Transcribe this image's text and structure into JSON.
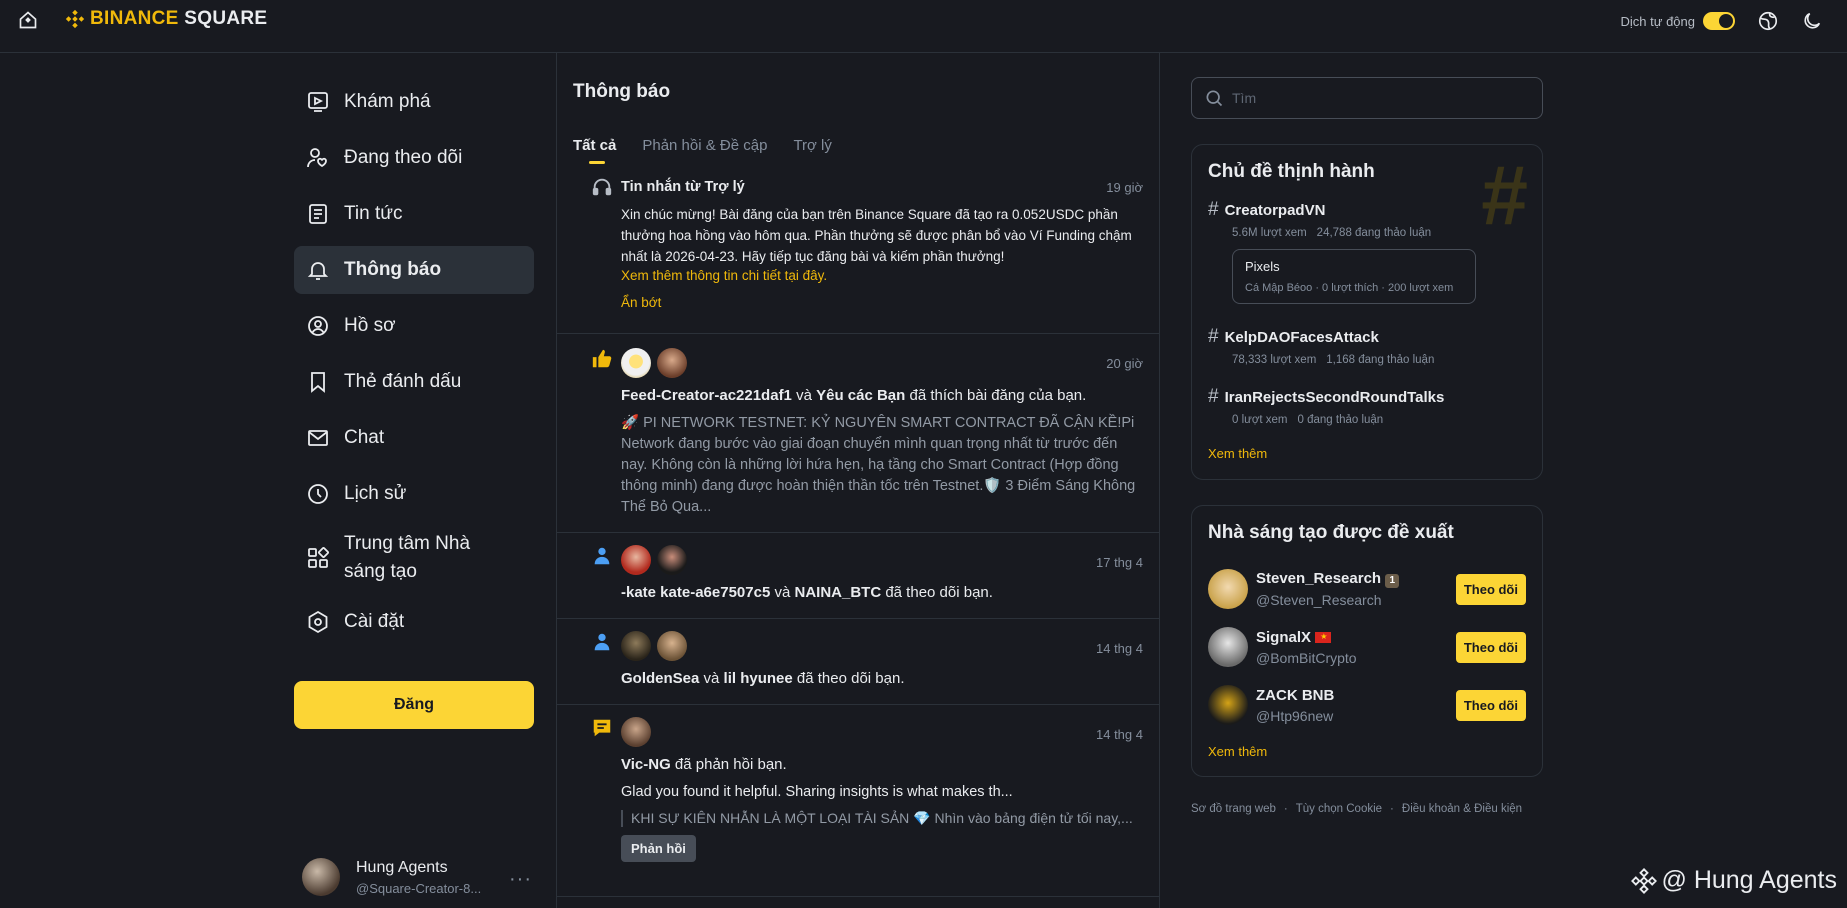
{
  "header": {
    "brand": "BINANCE",
    "brand_suffix": "SQUARE",
    "auto_translate_label": "Dịch tự động"
  },
  "nav": {
    "items": [
      {
        "label": "Khám phá",
        "icon": "discover-icon"
      },
      {
        "label": "Đang theo dõi",
        "icon": "following-icon"
      },
      {
        "label": "Tin tức",
        "icon": "news-icon"
      },
      {
        "label": "Thông báo",
        "icon": "bell-icon"
      },
      {
        "label": "Hồ sơ",
        "icon": "profile-icon"
      },
      {
        "label": "Thẻ đánh dấu",
        "icon": "bookmark-icon"
      },
      {
        "label": "Chat",
        "icon": "mail-icon"
      },
      {
        "label": "Lịch sử",
        "icon": "clock-icon"
      },
      {
        "label": "Trung tâm Nhà sáng tạo",
        "icon": "grid-icon"
      },
      {
        "label": "Cài đặt",
        "icon": "settings-icon"
      }
    ],
    "active_index": 3,
    "post_label": "Đăng"
  },
  "user": {
    "name": "Hung Agents",
    "handle": "@Square-Creator-8..."
  },
  "main": {
    "title": "Thông báo",
    "tabs": [
      "Tất cả",
      "Phản hồi & Đề cập",
      "Trợ lý"
    ],
    "notifications": [
      {
        "title": "Tin nhắn từ Trợ lý",
        "time": "19 giờ",
        "body": "Xin chúc mừng! Bài đăng của bạn trên Binance Square đã tạo ra 0.052USDC phần thưởng hoa hồng vào hôm qua. Phần thưởng sẽ được phân bổ vào Ví Funding chậm nhất là 2026-04-23. Hãy tiếp tục đăng bài và kiếm phần thưởng!",
        "details_link": "Xem thêm thông tin chi tiết tại đây.",
        "collapse_link": "Ẩn bớt"
      },
      {
        "time": "20 giờ",
        "actor1": "Feed-Creator-ac221daf1",
        "joiner": "và",
        "actor2": "Yêu các Bạn",
        "action": "đã thích bài đăng của bạn.",
        "excerpt": "🚀 PI NETWORK TESTNET: KỶ NGUYÊN SMART CONTRACT ĐÃ CẬN KỀ!Pi Network đang bước vào giai đoạn chuyển mình quan trọng nhất từ trước đến nay. Không còn là những lời hứa hẹn, hạ tầng cho Smart Contract (Hợp đồng thông minh) đang được hoàn thiện thần tốc trên Testnet.🛡️ 3 Điểm Sáng Không Thể Bỏ Qua..."
      },
      {
        "time": "17 thg 4",
        "actor1": "-kate kate-a6e7507c5",
        "joiner": "và",
        "actor2": "NAINA_BTC",
        "action": "đã theo dõi bạn."
      },
      {
        "time": "14 thg 4",
        "actor1": "GoldenSea",
        "joiner": "và",
        "actor2": "lil hyunee",
        "action": "đã theo dõi bạn."
      },
      {
        "time": "14 thg 4",
        "actor1": "Vic-NG",
        "action": "đã phản hồi bạn.",
        "reply": "Glad you found it helpful. Sharing insights is what makes th...",
        "quote": "KHI SỰ KIÊN NHẪN LÀ MỘT LOẠI TÀI SẢN 💎 Nhìn vào bảng điện tử tối nay,...",
        "reply_button": "Phản hồi"
      }
    ]
  },
  "sidebar": {
    "search_placeholder": "Tìm",
    "trending": {
      "title": "Chủ đề thịnh hành",
      "topics": [
        {
          "name": "CreatorpadVN",
          "views": "5.6M lượt xem",
          "discussing": "24,788 đang thảo luận"
        },
        {
          "name": "KelpDAOFacesAttack",
          "views": "78,333 lượt xem",
          "discussing": "1,168 đang thảo luận"
        },
        {
          "name": "IranRejectsSecondRoundTalks",
          "views": "0 lượt xem",
          "discussing": "0 đang thảo luận"
        }
      ],
      "featured_post": {
        "title": "Pixels",
        "meta": "Cá Mập Béoo · 0 lượt thích · 200 lượt xem"
      },
      "see_more": "Xem thêm"
    },
    "creators": {
      "title": "Nhà sáng tạo được đề xuất",
      "list": [
        {
          "name": "Steven_Research",
          "handle": "@Steven_Research",
          "badge": "1"
        },
        {
          "name": "SignalX",
          "handle": "@BomBitCrypto",
          "badge": "vn-flag"
        },
        {
          "name": "ZACK BNB",
          "handle": "@Htp96new",
          "badge": ""
        }
      ],
      "follow_label": "Theo dõi",
      "see_more": "Xem thêm"
    },
    "footer": [
      "Sơ đồ trang web",
      "Tùy chọn Cookie",
      "Điều khoản & Điều kiện"
    ]
  },
  "watermark": "@ Hung Agents",
  "colors": {
    "accent": "#fcd535",
    "brand": "#f0b90b",
    "bg": "#181a20",
    "border": "#2b3139"
  }
}
